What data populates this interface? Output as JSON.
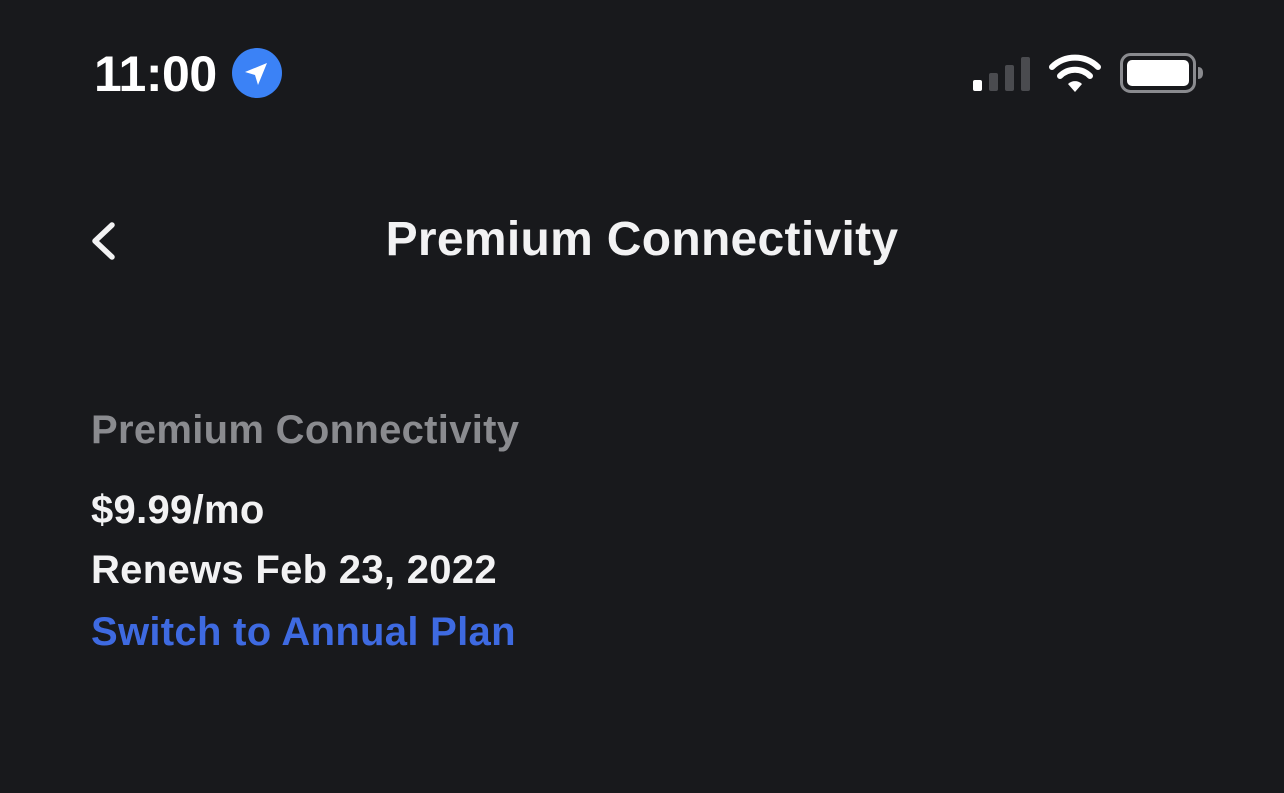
{
  "status_bar": {
    "time": "11:00",
    "icons": [
      "location-arrow-icon",
      "cellular-signal-icon",
      "wifi-icon",
      "battery-icon"
    ],
    "location_badge_color": "#3b82f6",
    "signal_bars_active": 1,
    "signal_bars_total": 4
  },
  "nav": {
    "back_icon": "chevron-left-icon",
    "title": "Premium Connectivity"
  },
  "plan": {
    "name": "Premium Connectivity",
    "price": "$9.99/mo",
    "renewal": "Renews Feb 23, 2022",
    "switch_link": "Switch to Annual Plan"
  },
  "colors": {
    "background": "#18191c",
    "primary_text": "#f2f2f3",
    "secondary_text": "#8a8b8f",
    "link": "#3e6ae1"
  }
}
